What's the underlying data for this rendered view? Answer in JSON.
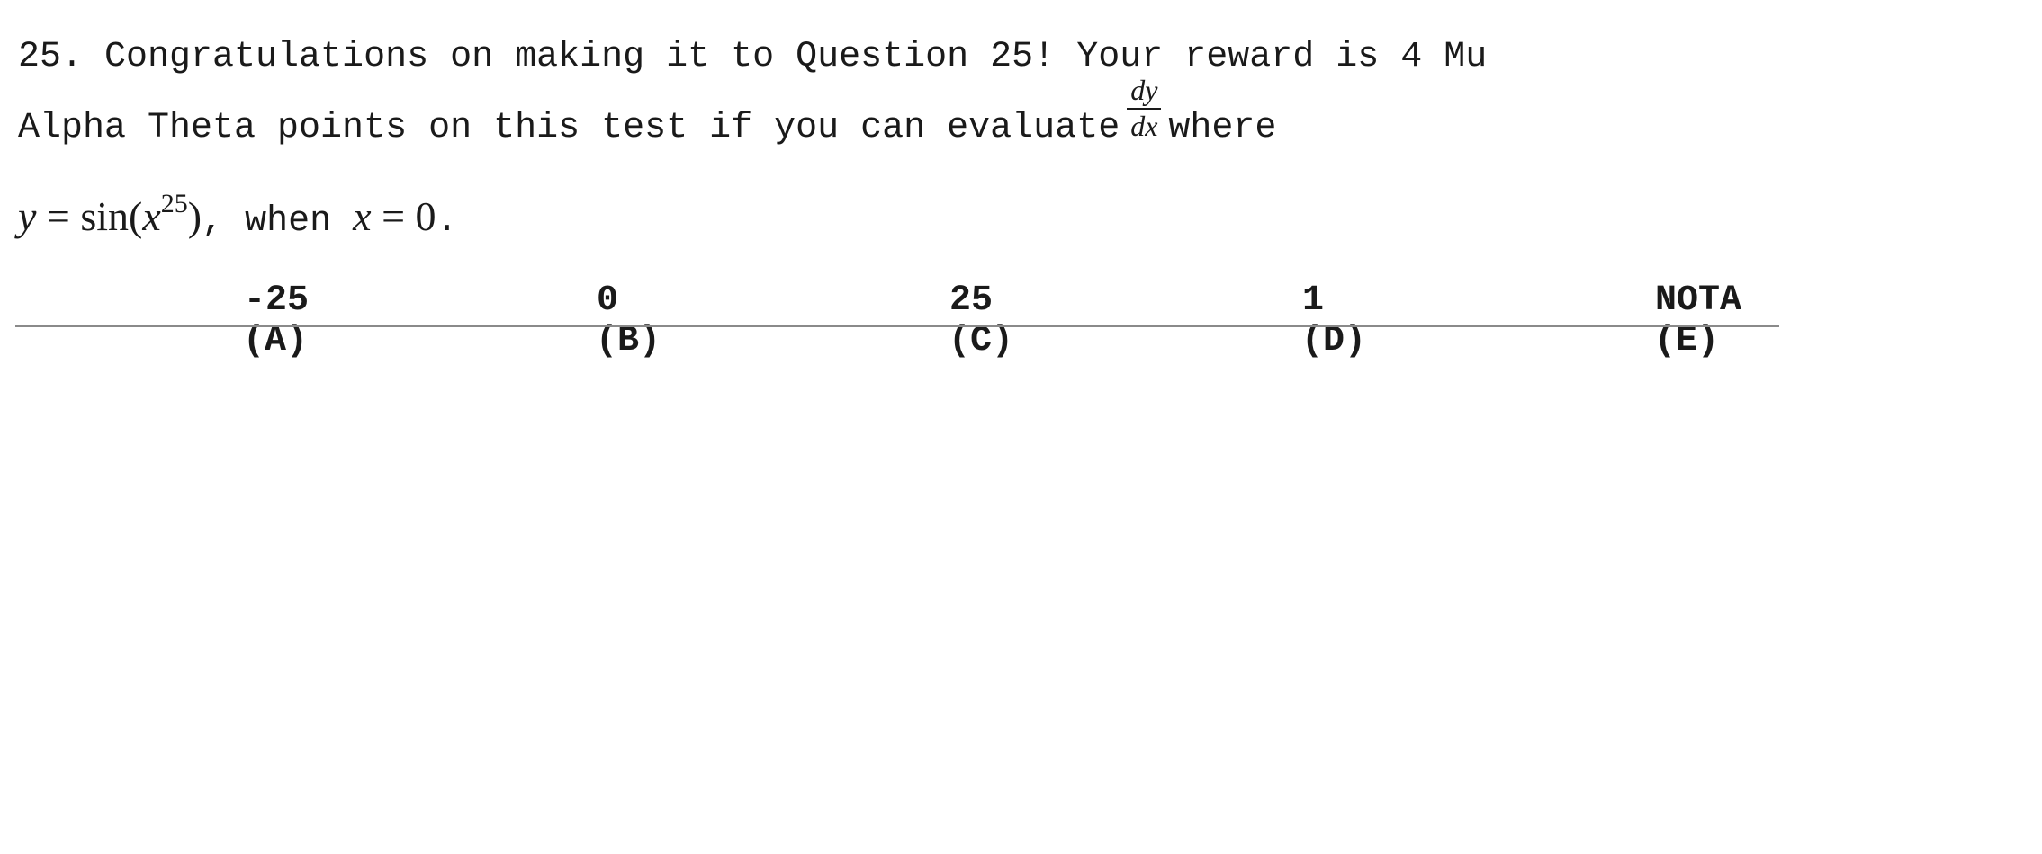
{
  "question": {
    "line1": "25. Congratulations on making it to Question 25! Your reward is 4 Mu",
    "line2_before": "Alpha Theta points on this test if you can evaluate",
    "derivative_numerator": "dy",
    "derivative_denominator": "dx",
    "line2_after": "where",
    "eq_y": "y",
    "eq_equals": " = sin(",
    "eq_x": "x",
    "eq_exponent": "25",
    "eq_close": ")",
    "comma_when": ", when ",
    "cond_x": "x",
    "cond_value": " = 0",
    "period": "."
  },
  "choices": [
    {
      "label": "(A)",
      "value": "-25"
    },
    {
      "label": "(B)",
      "value": "0"
    },
    {
      "label": "(C)",
      "value": "25"
    },
    {
      "label": "(D)",
      "value": "1"
    },
    {
      "label": "(E)",
      "value": "NOTA"
    }
  ]
}
